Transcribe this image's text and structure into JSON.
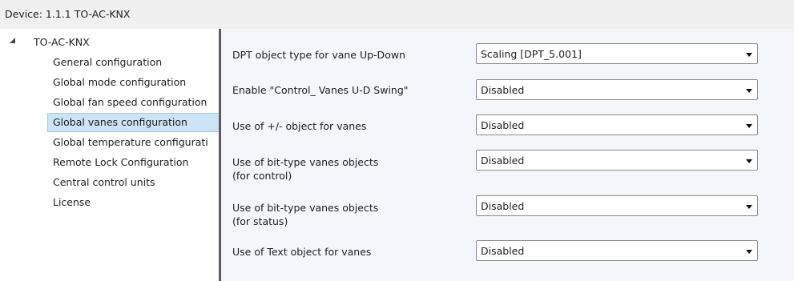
{
  "header": {
    "title": "Device: 1.1.1  TO-AC-KNX"
  },
  "tree": {
    "root_label": "TO-AC-KNX",
    "items": [
      {
        "label": "General configuration"
      },
      {
        "label": "Global mode configuration"
      },
      {
        "label": "Global fan speed configuration"
      },
      {
        "label": "Global vanes configuration",
        "selected": true
      },
      {
        "label": "Global temperature configurati"
      },
      {
        "label": "Remote Lock Configuration"
      },
      {
        "label": "Central control units"
      },
      {
        "label": "License"
      }
    ]
  },
  "panel": {
    "rows": [
      {
        "label": "DPT object type for vane Up-Down",
        "value": "Scaling [DPT_5.001]"
      },
      {
        "label": "Enable \"Control_ Vanes U-D Swing\"",
        "value": "Disabled"
      },
      {
        "label": "Use of +/- object for vanes",
        "value": "Disabled"
      },
      {
        "label": "Use of bit-type vanes objects",
        "label2": "(for control)",
        "value": "Disabled"
      },
      {
        "label": "Use of bit-type vanes objects",
        "label2": "(for status)",
        "value": "Disabled"
      },
      {
        "label": "Use of Text object for vanes",
        "value": "Disabled"
      }
    ]
  },
  "colors": {
    "selection": "#cce4f7",
    "panel_background": "#f3f6fa",
    "splitter": "#5c5c5c"
  }
}
